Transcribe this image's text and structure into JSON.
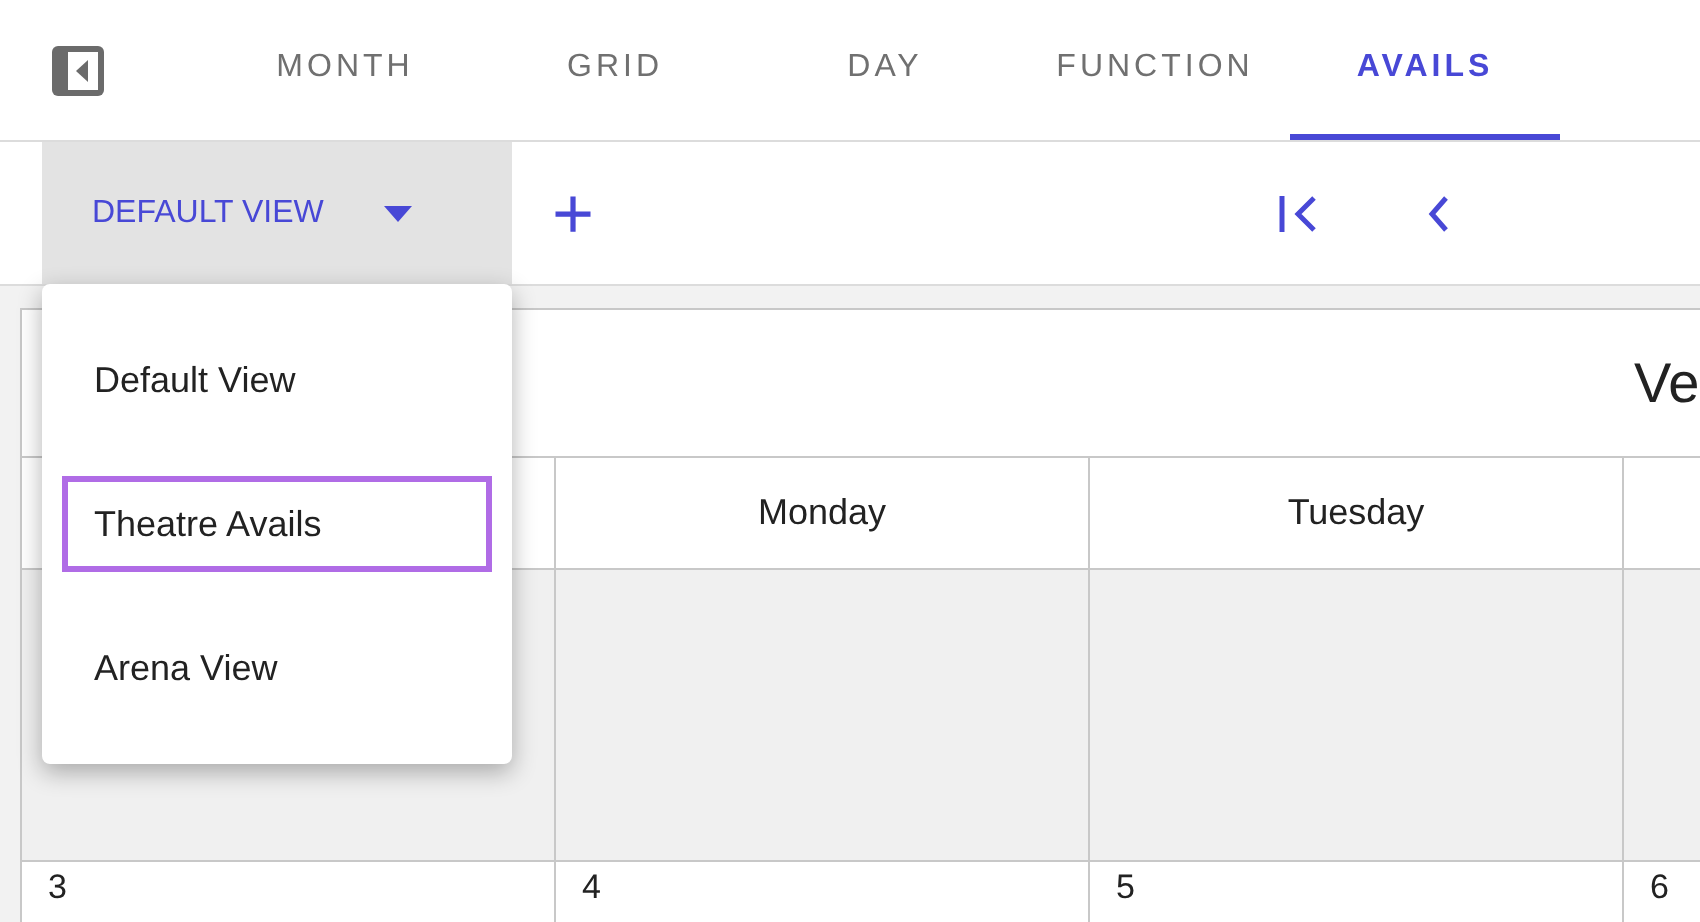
{
  "tabs": [
    {
      "label": "MONTH",
      "selected": false
    },
    {
      "label": "GRID",
      "selected": false
    },
    {
      "label": "DAY",
      "selected": false
    },
    {
      "label": "FUNCTION",
      "selected": false
    },
    {
      "label": "AVAILS",
      "selected": true
    }
  ],
  "toolbar": {
    "view_dropdown": "DEFAULT VIEW",
    "add": "+"
  },
  "view_menu": [
    {
      "label": "Default View",
      "focused": false
    },
    {
      "label": "Theatre Avails",
      "focused": true
    },
    {
      "label": "Arena View",
      "focused": false
    }
  ],
  "calendar": {
    "title": "Ve",
    "weekdays": [
      "Monday",
      "Tuesday"
    ],
    "week_rows": [
      {
        "shaded": true
      },
      {
        "shaded": false,
        "days": [
          "3",
          "4",
          "5",
          "6"
        ]
      }
    ]
  }
}
